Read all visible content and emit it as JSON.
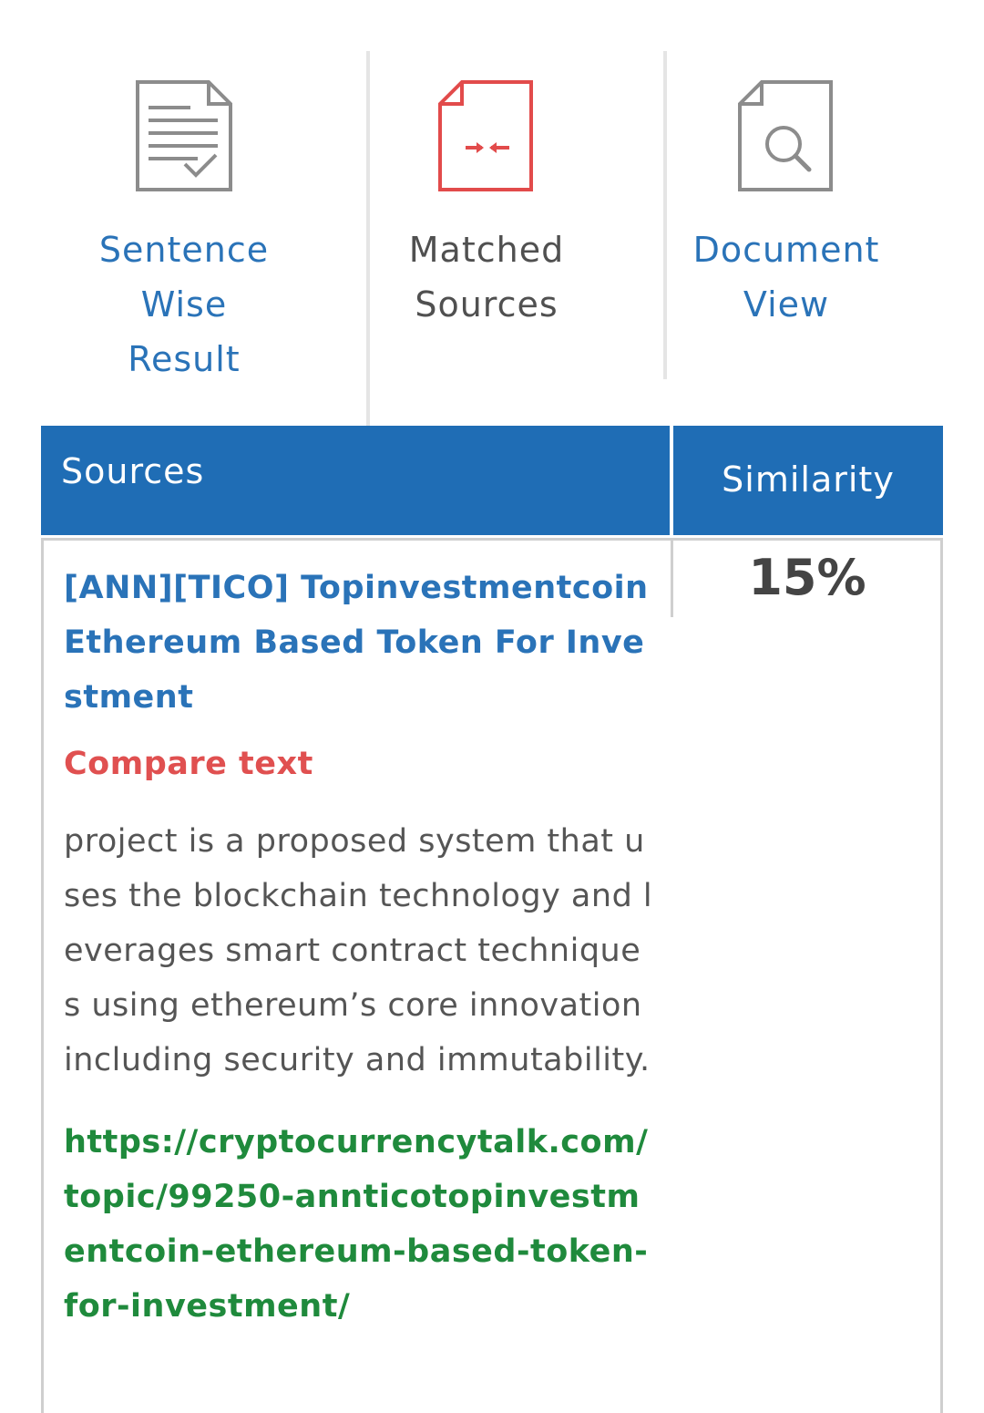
{
  "tabs": [
    {
      "label": "Sentence\nWise\nResult",
      "icon": "document-check-icon",
      "color": "#2a73b8"
    },
    {
      "label": "Matched\nSources",
      "icon": "document-compare-icon",
      "color": "#505050"
    },
    {
      "label": "Document\nView",
      "icon": "document-search-icon",
      "color": "#2a73b8"
    }
  ],
  "table": {
    "header_color": "#1f6db5",
    "columns": {
      "sources": "Sources",
      "similarity": "Similarity"
    },
    "rows": [
      {
        "title": "[ANN][TICO] Topinvestmentcoin Ethereum Based Token For Investment",
        "compare_label": "Compare text",
        "matched_text": "project is a proposed system that uses the blockchain technology and leverages smart contract techniques using ethereum’s core innovation including security and immutability.",
        "url": "https://cryptocurrencytalk.com/topic/99250-annticotopinvestmentcoin-ethereum-based-token-for-investment/",
        "similarity": "15%"
      }
    ]
  },
  "colors": {
    "link_blue": "#2a73b8",
    "compare_red": "#e05050",
    "url_green": "#1f8a3c",
    "icon_red": "#e24b4b",
    "icon_gray": "#8c8c8c"
  }
}
